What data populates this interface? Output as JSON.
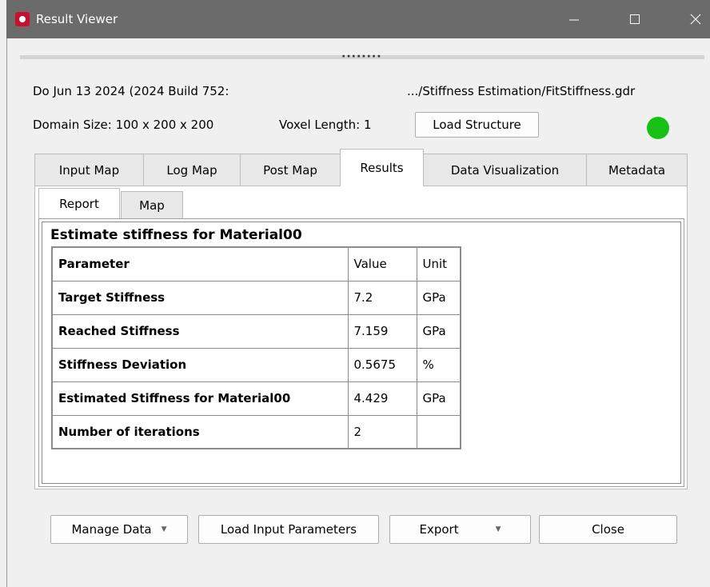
{
  "window": {
    "title": "Result Viewer"
  },
  "header": {
    "date_text": "Do Jun 13 2024 (2024 Build 752:",
    "path_text": ".../Stiffness Estimation/FitStiffness.gdr",
    "domain_text": "Domain Size: 100 x 200 x 200",
    "voxel_text": "Voxel Length: 1",
    "load_structure_label": "Load Structure",
    "status_color": "#17c017"
  },
  "tabs": [
    {
      "label": "Input Map"
    },
    {
      "label": "Log Map"
    },
    {
      "label": "Post Map"
    },
    {
      "label": "Results",
      "active": true
    },
    {
      "label": "Data Visualization"
    },
    {
      "label": "Metadata"
    }
  ],
  "subtabs": [
    {
      "label": "Report",
      "active": true
    },
    {
      "label": "Map"
    }
  ],
  "report": {
    "title": "Estimate stiffness for Material00",
    "columns": [
      "Parameter",
      "Value",
      "Unit"
    ],
    "rows": [
      [
        "Target Stiffness",
        "7.2",
        "GPa"
      ],
      [
        "Reached Stiffness",
        "7.159",
        "GPa"
      ],
      [
        "Stiffness Deviation",
        "0.5675",
        "%"
      ],
      [
        "Estimated Stiffness for Material00",
        "4.429",
        "GPa"
      ],
      [
        "Number of iterations",
        "2",
        ""
      ]
    ]
  },
  "footer": {
    "manage_data_label": "Manage Data",
    "load_input_label": "Load Input Parameters",
    "export_label": "Export",
    "close_label": "Close"
  }
}
